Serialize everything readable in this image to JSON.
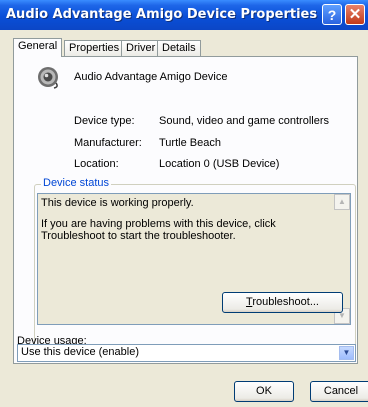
{
  "window": {
    "title": "Audio Advantage Amigo Device Properties",
    "help_symbol": "?",
    "close_symbol": "✕"
  },
  "tabs": [
    {
      "label": "General",
      "active": true
    },
    {
      "label": "Properties"
    },
    {
      "label": "Driver"
    },
    {
      "label": "Details"
    }
  ],
  "device": {
    "icon": "speaker-icon",
    "name": "Audio Advantage Amigo Device",
    "properties": [
      {
        "label": "Device type:",
        "value": "Sound, video and game controllers"
      },
      {
        "label": "Manufacturer:",
        "value": "Turtle Beach"
      },
      {
        "label": "Location:",
        "value": "Location 0 (USB Device)"
      }
    ]
  },
  "status": {
    "group_title": "Device status",
    "line1": "This device is working properly.",
    "line2": "If you are having problems with this device, click Troubleshoot to start the troubleshooter.",
    "troubleshoot_rest": "roubleshoot...",
    "troubleshoot_key": "T"
  },
  "usage": {
    "label_key": "D",
    "label_rest": "evice usage:",
    "selected": "Use this device (enable)"
  },
  "buttons": {
    "ok": "OK",
    "cancel": "Cancel"
  }
}
